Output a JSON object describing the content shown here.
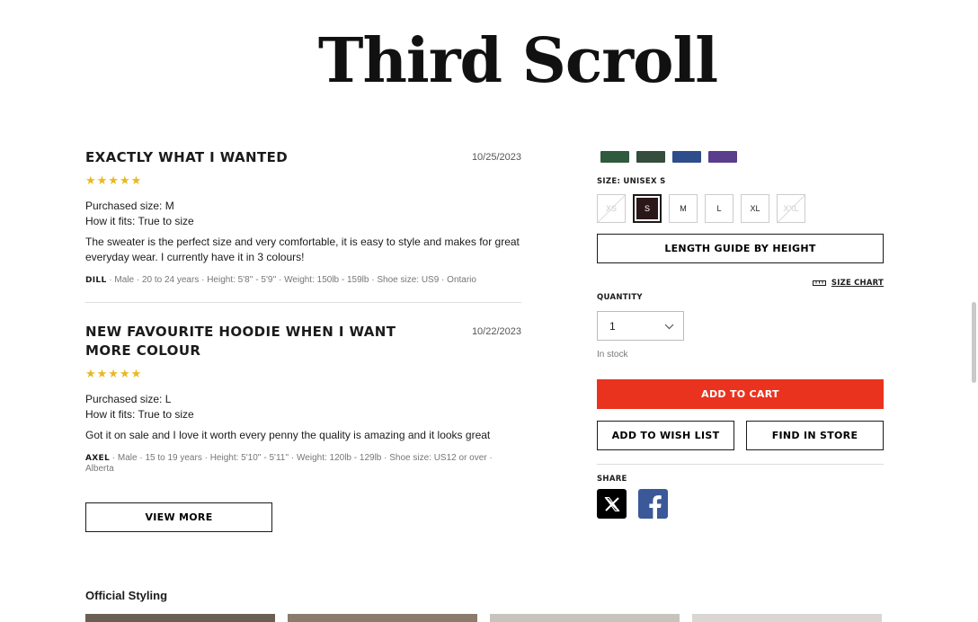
{
  "page_title": "Third Scroll",
  "reviews": [
    {
      "title": "Exactly what I wanted",
      "date": "10/25/2023",
      "stars": "★★★★★",
      "purchased_size": "Purchased size: M",
      "fit": "How it fits: True to size",
      "body": "The sweater is the perfect size and very comfortable, it is easy to style and makes for great everyday wear. I currently have it in 3 colours!",
      "reviewer_name": "DILL",
      "reviewer_details": " · Male · 20 to 24 years · Height: 5'8'' - 5'9'' · Weight: 150lb - 159lb · Shoe size: US9 · Ontario"
    },
    {
      "title": "New favourite hoodie when I want more colour",
      "date": "10/22/2023",
      "stars": "★★★★★",
      "purchased_size": "Purchased size: L",
      "fit": "How it fits: True to size",
      "body": "Got it on sale and I love it worth every penny the quality is amazing and it looks great",
      "reviewer_name": "AXEL",
      "reviewer_details": " · Male · 15 to 19 years · Height: 5'10'' - 5'11'' · Weight: 120lb - 129lb · Shoe size: US12 or over · Alberta"
    }
  ],
  "view_more_label": "VIEW MORE",
  "product": {
    "swatch_colors": [
      "#2f5a3e",
      "#344d3c",
      "#2e4d8a",
      "#5a3d8c"
    ],
    "size_label": "SIZE: UNISEX S",
    "sizes": [
      {
        "label": "XS",
        "state": "disabled"
      },
      {
        "label": "S",
        "state": "selected"
      },
      {
        "label": "M",
        "state": "available"
      },
      {
        "label": "L",
        "state": "available"
      },
      {
        "label": "XL",
        "state": "available"
      },
      {
        "label": "XXL",
        "state": "disabled"
      }
    ],
    "length_guide_label": "LENGTH GUIDE BY HEIGHT",
    "size_chart_label": "SIZE CHART",
    "quantity_label": "QUANTITY",
    "quantity_value": "1",
    "stock_text": "In stock",
    "add_to_cart_label": "ADD TO CART",
    "add_to_cart_color": "#e9331f",
    "wish_list_label": "ADD TO WISH LIST",
    "find_store_label": "FIND IN STORE",
    "share_label": "SHARE",
    "share_icons": [
      "x-icon",
      "facebook-icon"
    ]
  },
  "official_styling_label": "Official Styling"
}
